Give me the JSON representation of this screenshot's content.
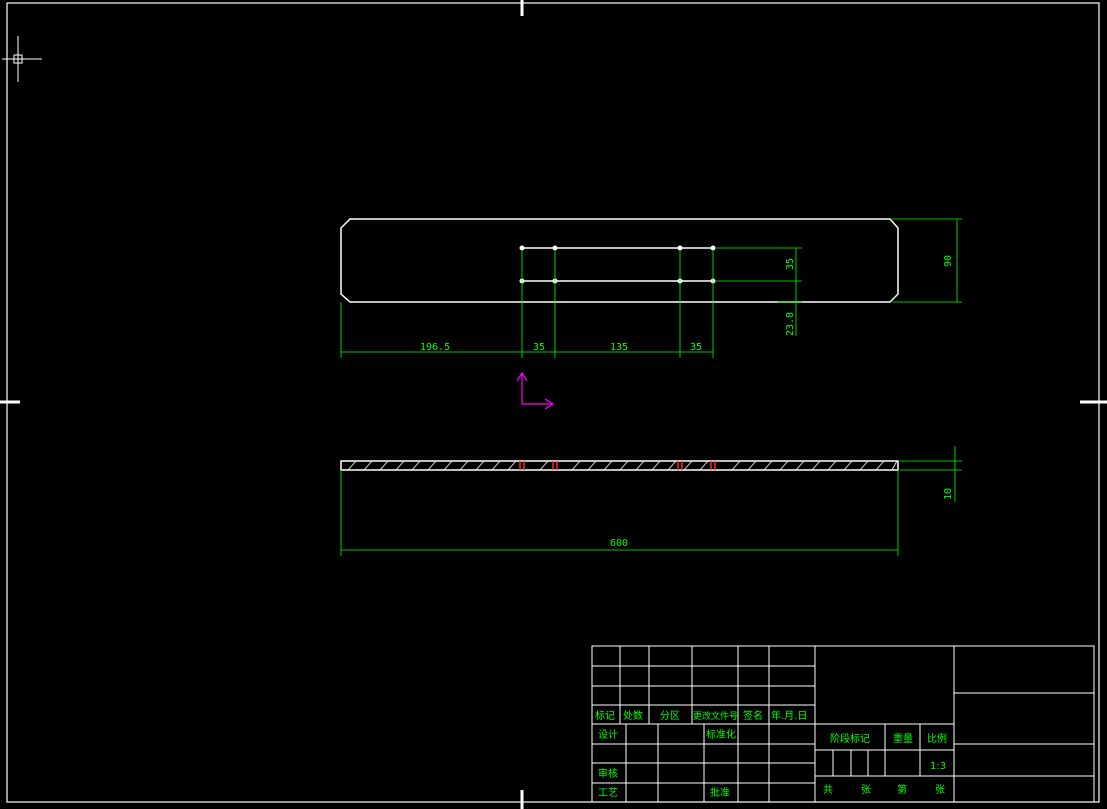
{
  "colors": {
    "background": "#000000",
    "geometry": "#ffffff",
    "dimension": "#00ff00",
    "ucs": "#ff00ff",
    "hole_section": "#ff3030"
  },
  "icons": {
    "crosshair": "crosshair-cursor-icon",
    "ucs": "ucs-axis-icon"
  },
  "dimensions": {
    "d1": "196.5",
    "d2": "35",
    "d3": "135",
    "d4": "35",
    "hole_spacing": "35",
    "edge_offset": "23.8",
    "width": "90",
    "length": "600",
    "thickness": "10"
  },
  "title_block": {
    "mark": "标记",
    "count": "处数",
    "zone": "分区",
    "change_doc": "更改文件号",
    "sign": "签名",
    "date": "年.月.日",
    "design": "设计",
    "standardize": "标准化",
    "stage_mark": "阶段标记",
    "weight": "重量",
    "scale": "比例",
    "scale_value": "1:3",
    "review": "审核",
    "process": "工艺",
    "approve": "批准",
    "total": "共",
    "sheets": "张",
    "page": "第",
    "sheet2": "张"
  }
}
